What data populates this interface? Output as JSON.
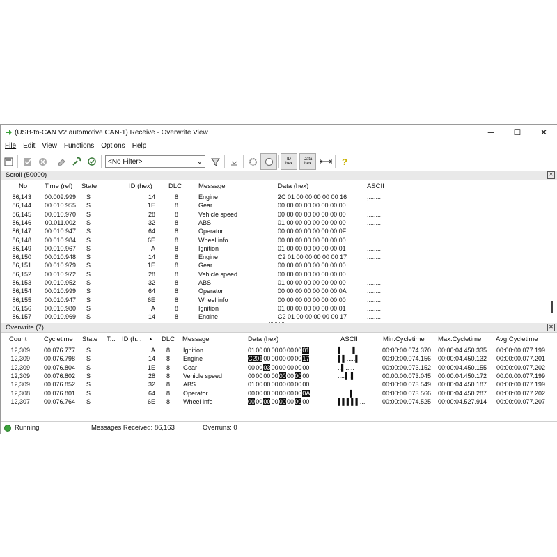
{
  "window": {
    "title": "(USB-to-CAN V2 automotive  CAN-1) Receive - Overwrite View",
    "ctrl_minimize": "─",
    "ctrl_maximize": "☐",
    "ctrl_close": "✕"
  },
  "menu": [
    "File",
    "Edit",
    "View",
    "Functions",
    "Options",
    "Help"
  ],
  "toolbar": {
    "filter_value": "<No Filter>",
    "id_hex": "ID\nhex",
    "data_hex": "Data\nhex"
  },
  "scroll": {
    "title": "Scroll (50000)",
    "columns": [
      "No",
      "Time (rel)",
      "State",
      "ID (hex)",
      "DLC",
      "Message",
      "Data (hex)",
      "ASCII"
    ],
    "rows": [
      [
        "86,143",
        "00.009.999",
        "S",
        "14",
        "8",
        "Engine",
        "2C 01 00 00 00 00 00 16",
        ",......."
      ],
      [
        "86,144",
        "00.010.955",
        "S",
        "1E",
        "8",
        "Gear",
        "00 00 00 00 00 00 00 00",
        "........"
      ],
      [
        "86,145",
        "00.010.970",
        "S",
        "28",
        "8",
        "Vehicle speed",
        "00 00 00 00 00 00 00 00",
        "........"
      ],
      [
        "86,146",
        "00.011.002",
        "S",
        "32",
        "8",
        "ABS",
        "01 00 00 00 00 00 00 00",
        "........"
      ],
      [
        "86,147",
        "00.010.947",
        "S",
        "64",
        "8",
        "Operator",
        "00 00 00 00 00 00 00 0F",
        "........"
      ],
      [
        "86,148",
        "00.010.984",
        "S",
        "6E",
        "8",
        "Wheel info",
        "00 00 00 00 00 00 00 00",
        "........"
      ],
      [
        "86,149",
        "00.010.967",
        "S",
        "A",
        "8",
        "Ignition",
        "01 00 00 00 00 00 00 01",
        "........"
      ],
      [
        "86,150",
        "00.010.948",
        "S",
        "14",
        "8",
        "Engine",
        "C2 01 00 00 00 00 00 17",
        "........"
      ],
      [
        "86,151",
        "00.010.979",
        "S",
        "1E",
        "8",
        "Gear",
        "00 00 00 00 00 00 00 00",
        "........"
      ],
      [
        "86,152",
        "00.010.972",
        "S",
        "28",
        "8",
        "Vehicle speed",
        "00 00 00 00 00 00 00 00",
        "........"
      ],
      [
        "86,153",
        "00.010.952",
        "S",
        "32",
        "8",
        "ABS",
        "01 00 00 00 00 00 00 00",
        "........"
      ],
      [
        "86,154",
        "00.010.999",
        "S",
        "64",
        "8",
        "Operator",
        "00 00 00 00 00 00 00 0A",
        "........"
      ],
      [
        "86,155",
        "00.010.947",
        "S",
        "6E",
        "8",
        "Wheel info",
        "00 00 00 00 00 00 00 00",
        "........"
      ],
      [
        "86,156",
        "00.010.980",
        "S",
        "A",
        "8",
        "Ignition",
        "01 00 00 00 00 00 00 01",
        "........"
      ],
      [
        "86,157",
        "00.010.969",
        "S",
        "14",
        "8",
        "Engine",
        "C2 01 00 00 00 00 00 17",
        "........"
      ]
    ]
  },
  "overwrite": {
    "title": "Overwrite (7)",
    "columns": [
      "Count",
      "Cycletime",
      "State",
      "T...",
      "ID (h...",
      "DLC",
      "Message",
      "Data (hex)",
      "ASCII",
      "Min.Cycletime",
      "Max.Cycletime",
      "Avg.Cycletime"
    ],
    "sort_indicator": "▲",
    "rows": [
      {
        "count": "12,309",
        "cycle": "00.076.777",
        "state": "S",
        "id": "A",
        "dlc": "8",
        "msg": "Ignition",
        "data": [
          "01",
          "00",
          "00",
          "00",
          "00",
          "00",
          "00",
          "01"
        ],
        "hl": [
          7
        ],
        "ascii": "▌......▌",
        "min": "00:00:00.074.370",
        "max": "00:00:04.450.335",
        "avg": "00:00:00.077.199"
      },
      {
        "count": "12,309",
        "cycle": "00.076.798",
        "state": "S",
        "id": "14",
        "dlc": "8",
        "msg": "Engine",
        "data": [
          "C2",
          "01",
          "00",
          "00",
          "00",
          "00",
          "00",
          "17"
        ],
        "hl": [
          0,
          1,
          7
        ],
        "ascii": "▌▌.....▌",
        "min": "00:00:00.074.156",
        "max": "00:00:04.450.132",
        "avg": "00:00:00.077.201"
      },
      {
        "count": "12,309",
        "cycle": "00.076.804",
        "state": "S",
        "id": "1E",
        "dlc": "8",
        "msg": "Gear",
        "data": [
          "00",
          "00",
          "03",
          "00",
          "00",
          "00",
          "00",
          "00"
        ],
        "hl": [
          2
        ],
        "ascii": "..▌.....",
        "min": "00:00:00.073.152",
        "max": "00:00:04.450.155",
        "avg": "00:00:00.077.202"
      },
      {
        "count": "12,309",
        "cycle": "00.076.802",
        "state": "S",
        "id": "28",
        "dlc": "8",
        "msg": "Vehicle speed",
        "data": [
          "00",
          "00",
          "00",
          "00",
          "00",
          "00",
          "00",
          "00"
        ],
        "hl": [
          4,
          6
        ],
        "ascii": "....▌.▌.",
        "min": "00:00:00.073.045",
        "max": "00:00:04.450.172",
        "avg": "00:00:00.077.199"
      },
      {
        "count": "12,309",
        "cycle": "00.076.852",
        "state": "S",
        "id": "32",
        "dlc": "8",
        "msg": "ABS",
        "data": [
          "01",
          "00",
          "00",
          "00",
          "00",
          "00",
          "00",
          "00"
        ],
        "hl": [],
        "ascii": "........",
        "min": "00:00:00.073.549",
        "max": "00:00:04.450.187",
        "avg": "00:00:00.077.199"
      },
      {
        "count": "12,308",
        "cycle": "00.076.801",
        "state": "S",
        "id": "64",
        "dlc": "8",
        "msg": "Operator",
        "data": [
          "00",
          "00",
          "00",
          "00",
          "00",
          "00",
          "00",
          "0A"
        ],
        "hl": [
          7
        ],
        "ascii": ".......▌",
        "min": "00:00:00.073.566",
        "max": "00:00:04.450.287",
        "avg": "00:00:00.077.202"
      },
      {
        "count": "12,307",
        "cycle": "00.076.764",
        "state": "S",
        "id": "6E",
        "dlc": "8",
        "msg": "Wheel info",
        "data": [
          "00",
          "00",
          "00",
          "00",
          "00",
          "00",
          "00",
          "00"
        ],
        "hl": [
          0,
          2,
          4,
          6
        ],
        "ascii": "▌▌▌▌▌...",
        "min": "00:00:00.074.525",
        "max": "00:00:04.527.914",
        "avg": "00:00:00.077.207"
      }
    ]
  },
  "status": {
    "state": "Running",
    "messages": "Messages Received: 86,163",
    "overruns": "Overruns: 0"
  }
}
